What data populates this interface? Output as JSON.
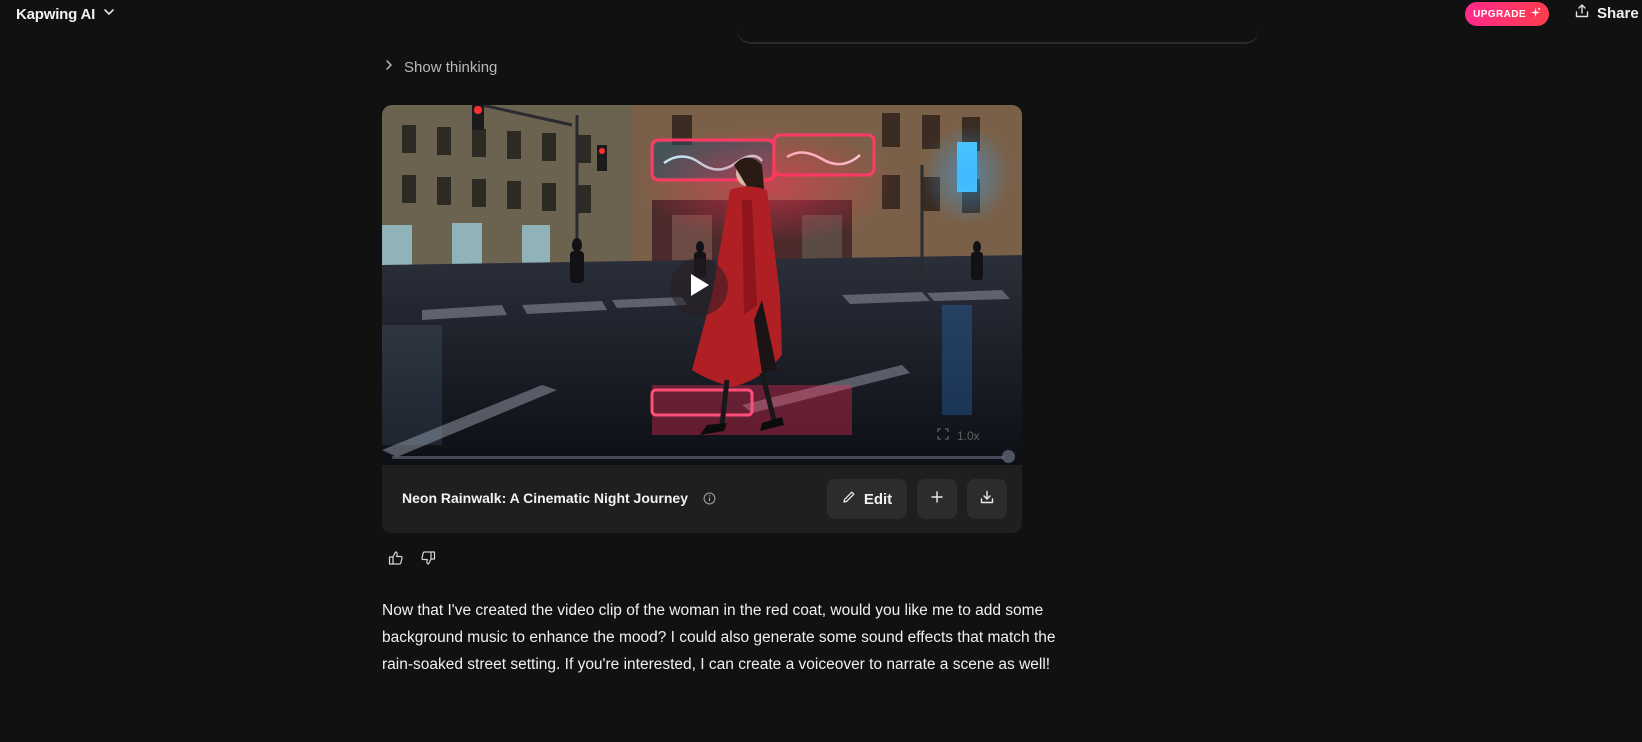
{
  "header": {
    "app_title": "Kapwing AI",
    "upgrade_label": "UPGRADE",
    "share_label": "Share"
  },
  "thinking": {
    "label": "Show thinking"
  },
  "video_card": {
    "title": "Neon Rainwalk: A Cinematic Night Journey",
    "edit_label": "Edit",
    "speed_label": "1.0x",
    "progress": 0.98
  },
  "message": {
    "text": "Now that I've created the video clip of the woman in the red coat, would you like me to add some background music to enhance the mood? I could also generate some sound effects that match the rain-soaked street setting. If you're interested, I can create a voiceover to narrate a scene as well!"
  },
  "colors": {
    "background": "#111111",
    "card": "#1f1f1f",
    "upgrade_start": "#ff2a8a",
    "upgrade_end": "#ff3d4e"
  }
}
